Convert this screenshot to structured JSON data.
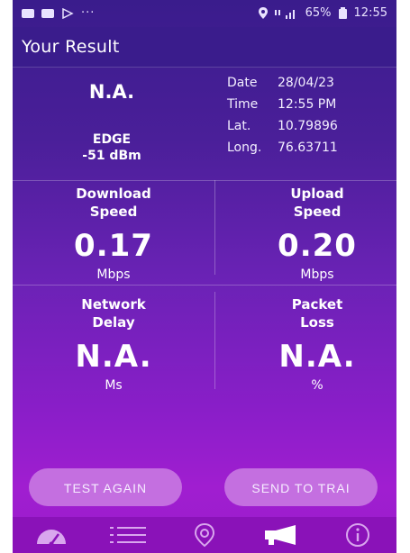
{
  "status_bar": {
    "left_icons": [
      "chat-icon",
      "image-icon",
      "media-icon"
    ],
    "dots": "···",
    "battery_text": "65%",
    "time": "12:55"
  },
  "header": {
    "title": "Your Result"
  },
  "network": {
    "result": "N.A.",
    "technology": "EDGE",
    "signal": "-51 dBm"
  },
  "details": [
    {
      "label": "Date",
      "value": "28/04/23"
    },
    {
      "label": "Time",
      "value": "12:55 PM"
    },
    {
      "label": "Lat.",
      "value": "10.79896"
    },
    {
      "label": "Long.",
      "value": "76.63711"
    }
  ],
  "metrics": {
    "download": {
      "line1": "Download",
      "line2": "Speed",
      "value": "0.17",
      "unit": "Mbps"
    },
    "upload": {
      "line1": "Upload",
      "line2": "Speed",
      "value": "0.20",
      "unit": "Mbps"
    },
    "delay": {
      "line1": "Network",
      "line2": "Delay",
      "value": "N.A.",
      "unit": "Ms"
    },
    "loss": {
      "line1": "Packet",
      "line2": "Loss",
      "value": "N.A.",
      "unit": "%"
    }
  },
  "actions": {
    "test_again": "TEST AGAIN",
    "send": "SEND TO TRAI"
  },
  "nav": {
    "items": [
      "speedometer-icon",
      "list-icon",
      "location-pin-icon",
      "megaphone-icon",
      "info-icon"
    ],
    "active": "megaphone-icon"
  },
  "colors": {
    "background_top": "#3a1c8c",
    "background_bottom": "#a01ed0",
    "button": "#c46fe0",
    "nav_bar": "#8a12b8"
  }
}
